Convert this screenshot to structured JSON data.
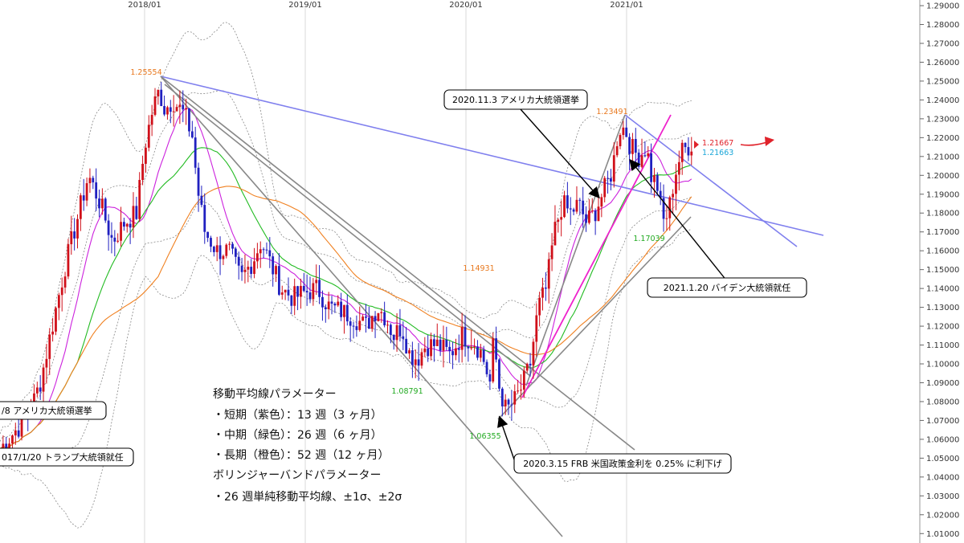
{
  "chart_data": {
    "type": "candlestick",
    "instrument_axis": {
      "y_ticks": [
        "1.29000",
        "1.28000",
        "1.27000",
        "1.26000",
        "1.25000",
        "1.24000",
        "1.23000",
        "1.22000",
        "1.21000",
        "1.20000",
        "1.19000",
        "1.18000",
        "1.17000",
        "1.16000",
        "1.15000",
        "1.14000",
        "1.13000",
        "1.12000",
        "1.11000",
        "1.10000",
        "1.09000",
        "1.08000",
        "1.07000",
        "1.06000",
        "1.05000",
        "1.04000",
        "1.03000",
        "1.02000",
        "1.01000"
      ],
      "ylim": [
        1.005,
        1.293
      ],
      "x_ticks": [
        "2018/01",
        "2019/01",
        "2020/01",
        "2021/01"
      ]
    },
    "price_labels": [
      {
        "label": "1.25554",
        "value": 1.25554,
        "color": "#e8781e"
      },
      {
        "label": "1.14931",
        "value": 1.14931,
        "color": "#e8781e"
      },
      {
        "label": "1.23491",
        "value": 1.23491,
        "color": "#e8781e"
      },
      {
        "label": "1.08791",
        "value": 1.08791,
        "color": "#22aa22"
      },
      {
        "label": "1.06355",
        "value": 1.06355,
        "color": "#22aa22"
      },
      {
        "label": "1.17039",
        "value": 1.17039,
        "color": "#22aa22"
      },
      {
        "label": "1.21667",
        "value": 1.21667,
        "color": "#e0222a"
      },
      {
        "label": "1.21663",
        "value": 1.21663,
        "color": "#1aa6d8"
      }
    ],
    "annotations": [
      {
        "text": "2020.11.3 アメリカ大統領選挙"
      },
      {
        "text": "2021.1.20 バイデン大統領就任"
      },
      {
        "text": "2020.3.15 FRB 米国政策金利を 0.25% に利下げ"
      },
      {
        "text": "/8 アメリカ大統領選挙"
      },
      {
        "text": "017/1/20 トランプ大統領就任"
      }
    ],
    "parameters_text": [
      "移動平均線パラメーター",
      "・短期（紫色）：13 週（3 ヶ月）",
      "・中期（緑色）：26 週（6 ヶ月）",
      "・長期（橙色）：52 週（12 ヶ月）",
      "ボリンジャーバンドパラメーター",
      "・26 週単純移動平均線、±1σ、±2σ"
    ],
    "path_anchors": [
      [
        0,
        1.055
      ],
      [
        20,
        1.065
      ],
      [
        35,
        1.072
      ],
      [
        50,
        1.09
      ],
      [
        65,
        1.12
      ],
      [
        80,
        1.15
      ],
      [
        95,
        1.175
      ],
      [
        110,
        1.2
      ],
      [
        125,
        1.185
      ],
      [
        140,
        1.165
      ],
      [
        155,
        1.175
      ],
      [
        170,
        1.18
      ],
      [
        180,
        1.215
      ],
      [
        190,
        1.235
      ],
      [
        198,
        1.245
      ],
      [
        205,
        1.235
      ],
      [
        215,
        1.24
      ],
      [
        230,
        1.232
      ],
      [
        240,
        1.22
      ],
      [
        245,
        1.195
      ],
      [
        255,
        1.17
      ],
      [
        270,
        1.16
      ],
      [
        285,
        1.16
      ],
      [
        300,
        1.145
      ],
      [
        315,
        1.155
      ],
      [
        325,
        1.165
      ],
      [
        335,
        1.155
      ],
      [
        350,
        1.14
      ],
      [
        365,
        1.135
      ],
      [
        380,
        1.138
      ],
      [
        395,
        1.14
      ],
      [
        410,
        1.13
      ],
      [
        425,
        1.128
      ],
      [
        440,
        1.125
      ],
      [
        455,
        1.12
      ],
      [
        470,
        1.13
      ],
      [
        480,
        1.125
      ],
      [
        490,
        1.115
      ],
      [
        500,
        1.12
      ],
      [
        510,
        1.105
      ],
      [
        520,
        1.103
      ],
      [
        530,
        1.11
      ],
      [
        545,
        1.11
      ],
      [
        560,
        1.105
      ],
      [
        575,
        1.115
      ],
      [
        590,
        1.112
      ],
      [
        600,
        1.105
      ],
      [
        610,
        1.09
      ],
      [
        615,
        1.115
      ],
      [
        620,
        1.09
      ],
      [
        630,
        1.075
      ],
      [
        640,
        1.08
      ],
      [
        650,
        1.088
      ],
      [
        660,
        1.1
      ],
      [
        670,
        1.13
      ],
      [
        680,
        1.14
      ],
      [
        690,
        1.17
      ],
      [
        700,
        1.185
      ],
      [
        710,
        1.18
      ],
      [
        720,
        1.185
      ],
      [
        730,
        1.175
      ],
      [
        740,
        1.18
      ],
      [
        750,
        1.19
      ],
      [
        760,
        1.2
      ],
      [
        765,
        1.21
      ],
      [
        770,
        1.225
      ],
      [
        778,
        1.225
      ],
      [
        785,
        1.215
      ],
      [
        795,
        1.21
      ],
      [
        805,
        1.215
      ],
      [
        810,
        1.2
      ],
      [
        818,
        1.195
      ],
      [
        825,
        1.175
      ],
      [
        832,
        1.18
      ],
      [
        840,
        1.2
      ],
      [
        848,
        1.212
      ],
      [
        855,
        1.215
      ],
      [
        862,
        1.217
      ]
    ],
    "ma_short_color": "#cc22dd",
    "ma_mid_color": "#22bb22",
    "ma_long_color": "#f08020",
    "trendline_blue_color": "#8080ee",
    "trendline_magenta_color": "#ee22cc",
    "trendline_gray_color": "#888888",
    "up_candle_color": "#d0101a",
    "down_candle_color": "#2020c0"
  }
}
